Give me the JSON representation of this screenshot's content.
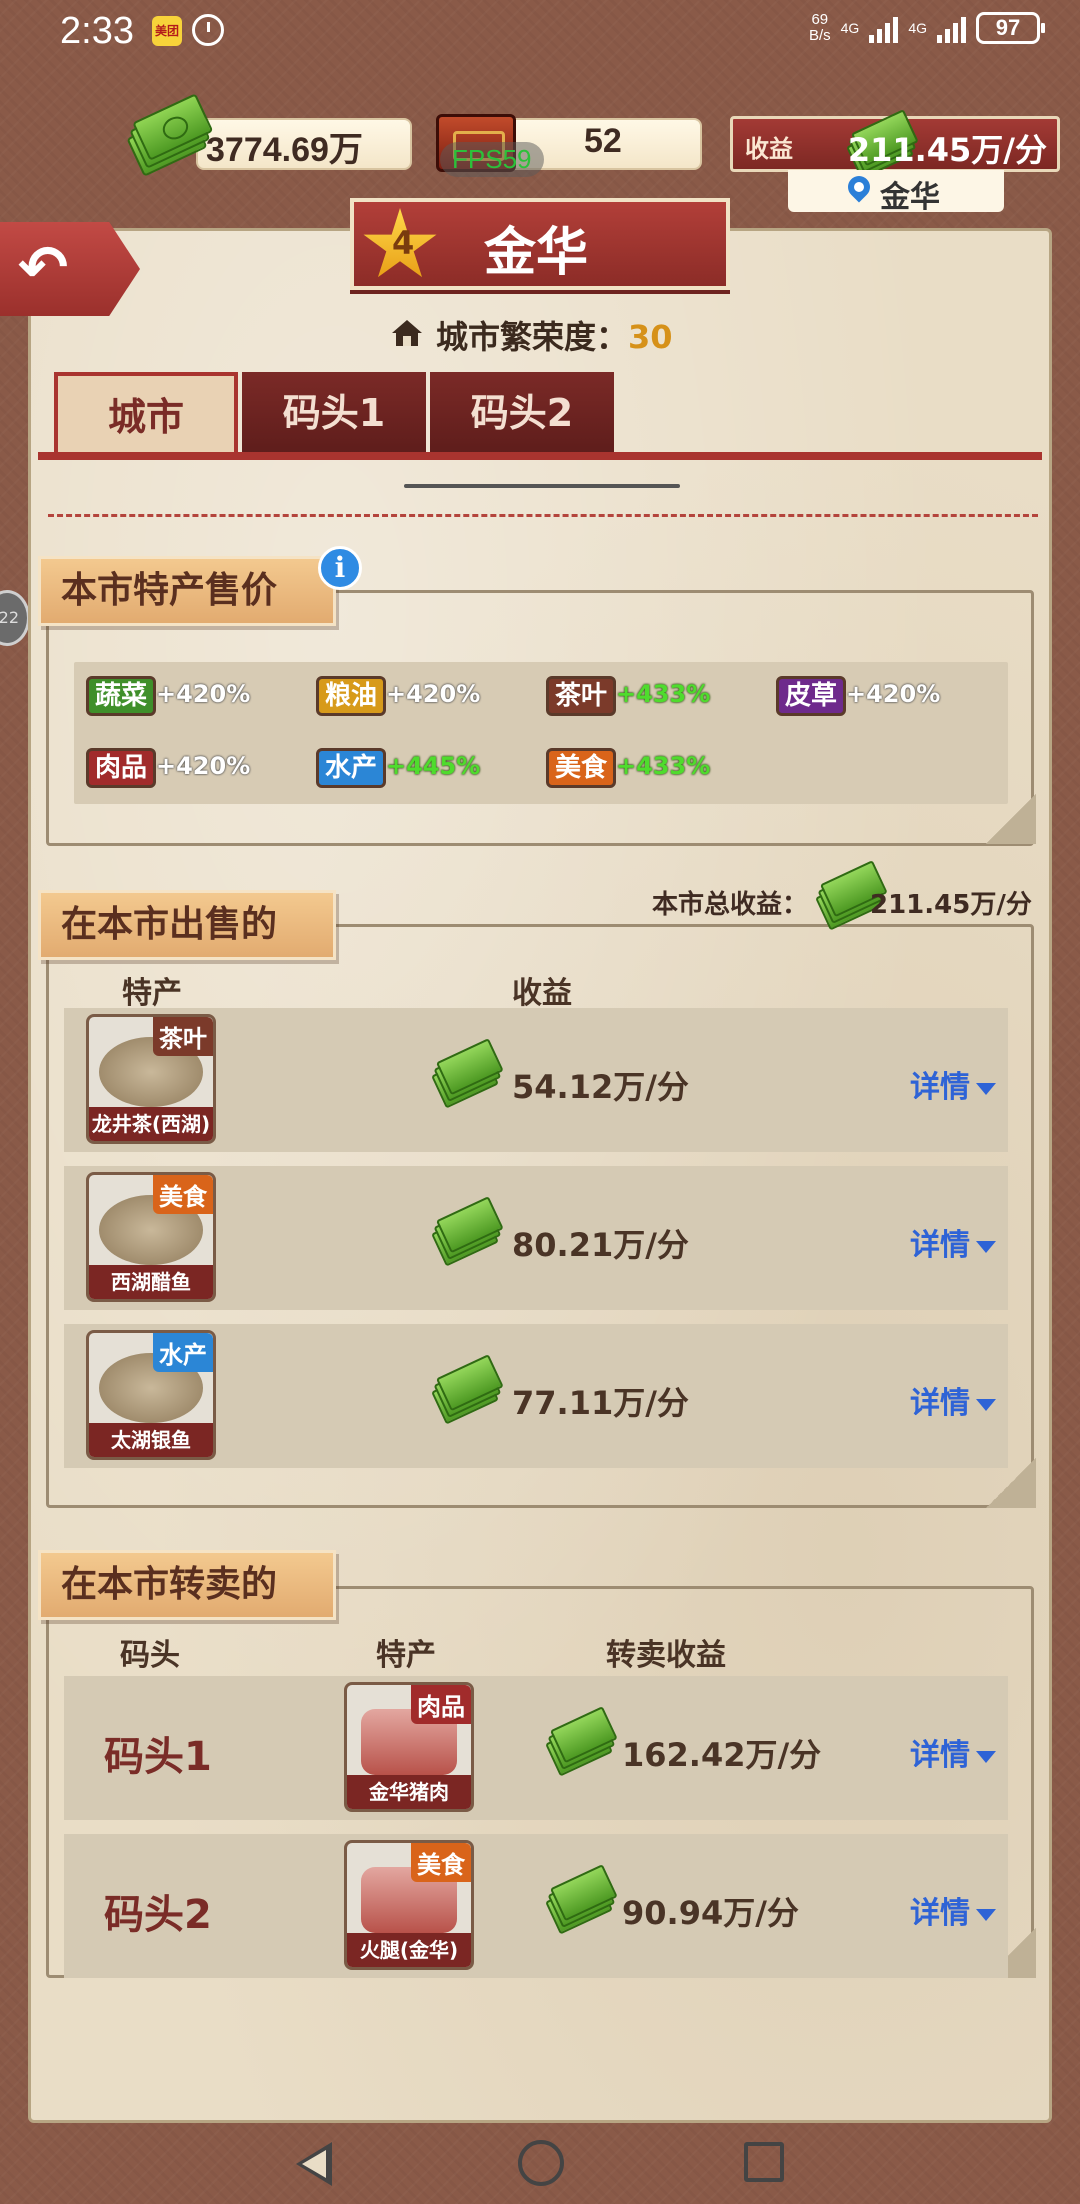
{
  "status_bar": {
    "time": "2:33",
    "app_badge": "美团",
    "speed_top": "69",
    "speed_bottom": "B/s",
    "net1": "4G",
    "net2": "4G",
    "battery": "97"
  },
  "resources": {
    "cash": "3774.69万",
    "tea_count": "52",
    "fps": "FPS59",
    "income_label": "收益",
    "income_value": "211.45万/分",
    "location": "金华"
  },
  "header": {
    "level": "4",
    "city_name": "金华",
    "prosperity_label": "城市繁荣度：",
    "prosperity_value": "30"
  },
  "tabs": [
    {
      "label": "城市",
      "active": true
    },
    {
      "label": "码头1",
      "active": false
    },
    {
      "label": "码头2",
      "active": false
    }
  ],
  "specialty_prices": {
    "title": "本市特产售价",
    "info_icon": "i",
    "items": [
      {
        "name": "蔬菜",
        "pct": "+420%",
        "color": "#3f8f2a",
        "highlight": false
      },
      {
        "name": "粮油",
        "pct": "+420%",
        "color": "#d79a1a",
        "highlight": false
      },
      {
        "name": "茶叶",
        "pct": "+433%",
        "color": "#7b3a2a",
        "highlight": true
      },
      {
        "name": "皮草",
        "pct": "+420%",
        "color": "#6e2a8c",
        "highlight": false
      },
      {
        "name": "肉品",
        "pct": "+420%",
        "color": "#a12b2b",
        "highlight": false
      },
      {
        "name": "水产",
        "pct": "+445%",
        "color": "#2b86d6",
        "highlight": true
      },
      {
        "name": "美食",
        "pct": "+433%",
        "color": "#d9641a",
        "highlight": true
      }
    ]
  },
  "sold_here": {
    "title": "在本市出售的",
    "total_label": "本市总收益：",
    "total_value": "211.45万/分",
    "col_specialty": "特产",
    "col_income": "收益",
    "detail_label": "详情",
    "items": [
      {
        "category": "茶叶",
        "category_color": "#7b3a2a",
        "name": "龙井茶(西湖)",
        "income": "54.12万/分"
      },
      {
        "category": "美食",
        "category_color": "#d9641a",
        "name": "西湖醋鱼",
        "income": "80.21万/分"
      },
      {
        "category": "水产",
        "category_color": "#2b86d6",
        "name": "太湖银鱼",
        "income": "77.11万/分"
      }
    ]
  },
  "resold_here": {
    "title": "在本市转卖的",
    "col_dock": "码头",
    "col_specialty": "特产",
    "col_income": "转卖收益",
    "detail_label": "详情",
    "items": [
      {
        "dock": "码头1",
        "category": "肉品",
        "category_color": "#a12b2b",
        "name": "金华猪肉",
        "income": "162.42万/分"
      },
      {
        "dock": "码头2",
        "category": "美食",
        "category_color": "#d9641a",
        "name": "火腿(金华)",
        "income": "90.94万/分"
      }
    ]
  },
  "side_bubble": "22"
}
